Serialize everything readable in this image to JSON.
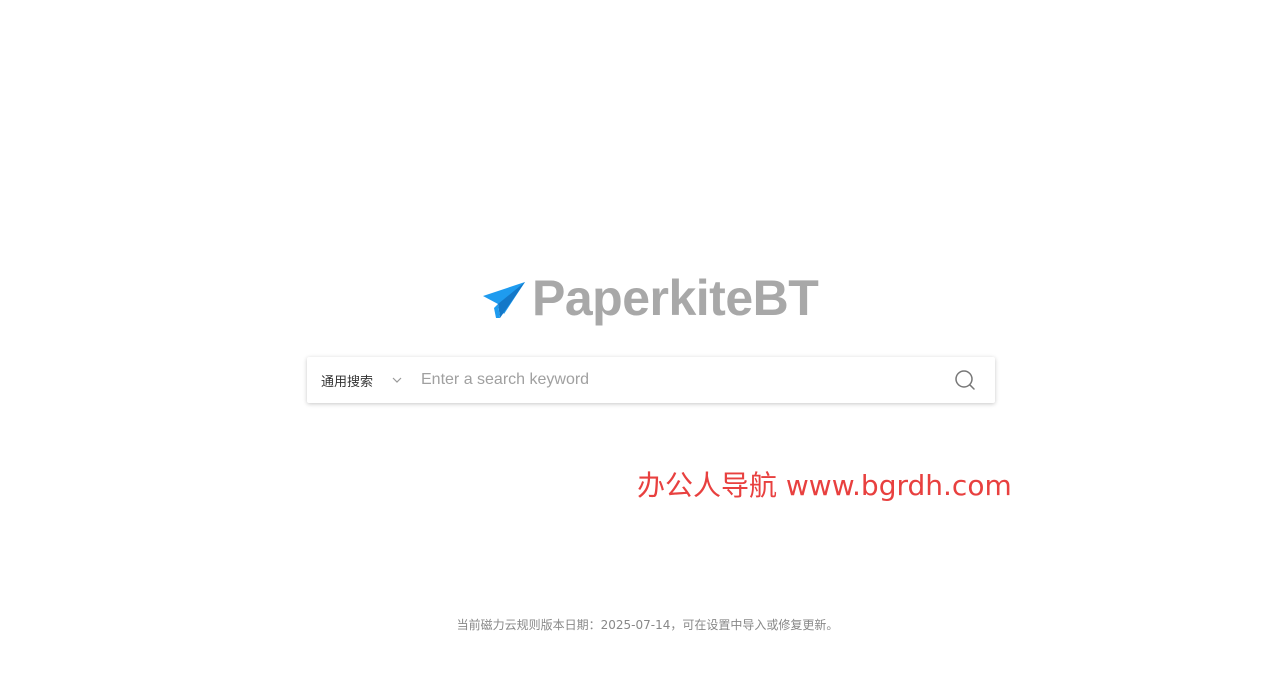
{
  "logo": {
    "text": "PaperkiteBT",
    "icon": "paper-plane-icon",
    "icon_color": "#1e9bef",
    "text_color": "#a8a8a8"
  },
  "search": {
    "engine_selected": "通用搜索",
    "placeholder": "Enter a search keyword",
    "value": "",
    "search_icon": "search-icon",
    "chevron_icon": "chevron-down-icon"
  },
  "watermark": {
    "text": "办公人导航  www.bgrdh.com",
    "color": "#e8403f"
  },
  "footer": {
    "text": "当前磁力云规则版本日期：2025-07-14，可在设置中导入或修复更新。"
  }
}
